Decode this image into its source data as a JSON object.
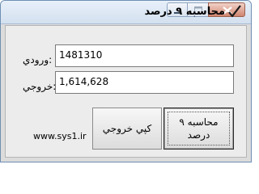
{
  "window": {
    "title": "محاسبه ۹ درصد"
  },
  "form": {
    "input_label": "ورودي:",
    "input_value": "1481310",
    "output_label": "خروجي:",
    "output_value": "1,614,628"
  },
  "buttons": {
    "calculate_label": "محاسبه ۹\nدرصد",
    "copy_output_label": "کپي خروجي"
  },
  "footer": {
    "website": "www.sys1.ir"
  },
  "icons": {
    "app": "checkmark-icon",
    "minimize": "minimize-icon",
    "maximize": "maximize-icon",
    "close": "close-icon"
  }
}
